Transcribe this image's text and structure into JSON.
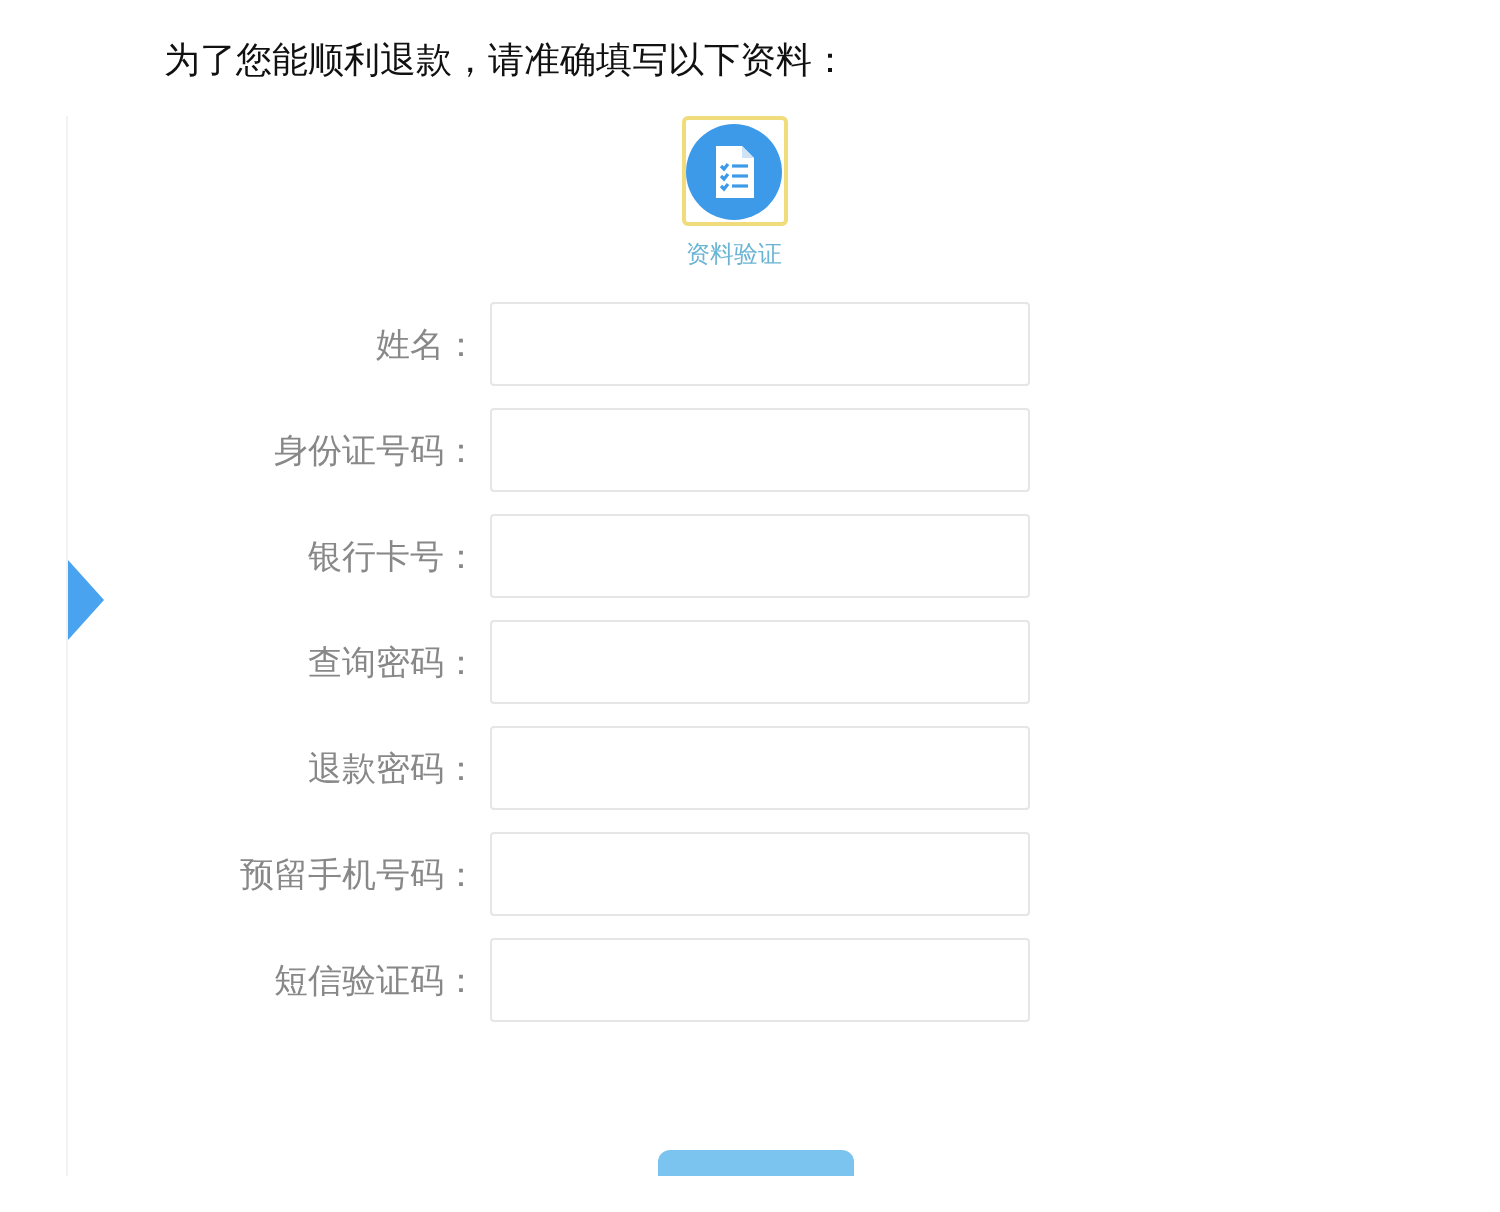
{
  "heading": "为了您能顺利退款，请准确填写以下资料：",
  "step": {
    "label": "资料验证"
  },
  "fields": [
    {
      "label": "姓名："
    },
    {
      "label": "身份证号码："
    },
    {
      "label": "银行卡号："
    },
    {
      "label": "查询密码："
    },
    {
      "label": "退款密码："
    },
    {
      "label": "预留手机号码："
    },
    {
      "label": "短信验证码："
    }
  ]
}
